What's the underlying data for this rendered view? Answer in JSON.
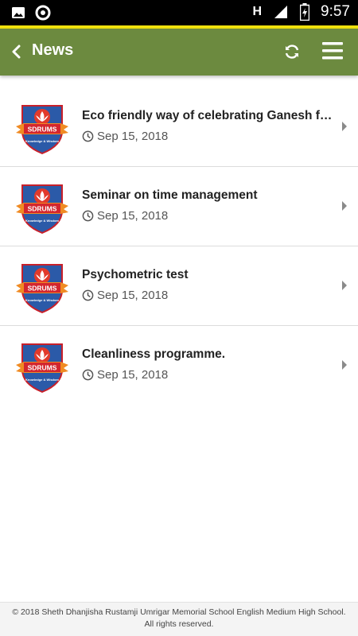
{
  "status_bar": {
    "time": "9:57",
    "network_letter": "H",
    "icons": [
      "image-icon",
      "circle-icon",
      "signal-icon",
      "battery-charging-icon"
    ]
  },
  "app_bar": {
    "title": "News",
    "back_icon": "chevron-left-icon",
    "refresh_icon": "refresh-icon",
    "menu_icon": "hamburger-menu-icon",
    "color": "#6c8a3f",
    "stripe_color": "#f1e20c"
  },
  "news": {
    "logo_text": "SDRUMS",
    "logo_tagline": "Knowledge & Wisdom",
    "items": [
      {
        "title": "Eco friendly way of celebrating Ganesh fe...",
        "date": "Sep 15, 2018"
      },
      {
        "title": "Seminar on time management",
        "date": "Sep 15, 2018"
      },
      {
        "title": "Psychometric test",
        "date": "Sep 15, 2018"
      },
      {
        "title": "Cleanliness programme.",
        "date": "Sep 15, 2018"
      }
    ]
  },
  "footer": {
    "text": "© 2018 Sheth Dhanjisha Rustamji Umrigar Memorial School English Medium High School. All rights reserved."
  }
}
